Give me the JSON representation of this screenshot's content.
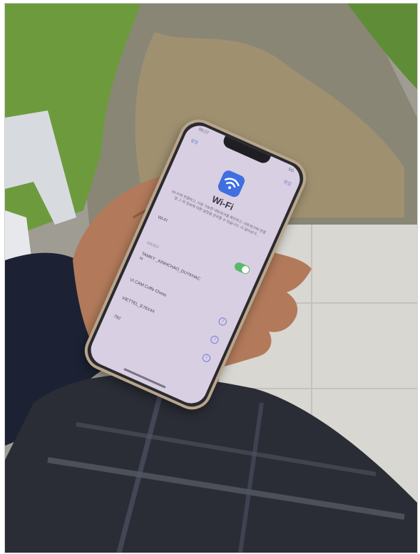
{
  "phone": {
    "status_time": "09:27",
    "status_right": "5G",
    "back_label": "설정",
    "edit_label": "편집",
    "settings_title": "Wi-Fi",
    "description": "Wi-Fi에 연결하고, 사용 가능한 네트워크를 확인하고, 네트워크에 연결 및 그 외 정보에 대한 설정을 관리할 수 있습니다. 더 알아보기...",
    "wifi_label": "Wi-Fi",
    "section_label": "네트워크",
    "networks": [
      {
        "name": "TAMKY _KINHCHAO_DUYKHAC H"
      },
      {
        "name": "VI CAM Coffe Chess"
      },
      {
        "name": "VIETTEL_E76X4X"
      },
      {
        "name": "792"
      }
    ],
    "info_glyph": "i"
  },
  "colors": {
    "screen_bg": "#d8cfe2",
    "accent_blue": "#3f6fe0",
    "toggle_green": "#58b96a",
    "phone_frame": "#b8a58c"
  },
  "icons": [
    "wifi-icon",
    "info-icon",
    "lock-icon",
    "toggle-switch"
  ]
}
